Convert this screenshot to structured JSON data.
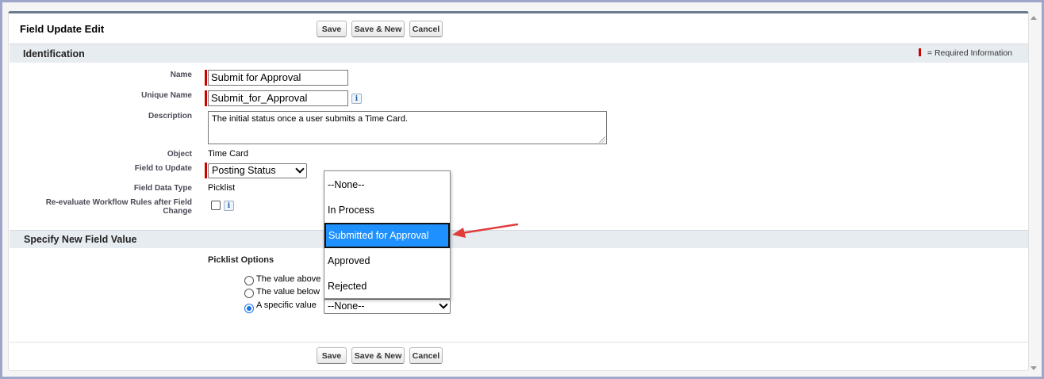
{
  "page": {
    "title": "Field Update Edit",
    "buttons": {
      "save": "Save",
      "save_new": "Save & New",
      "cancel": "Cancel"
    }
  },
  "identification": {
    "header": "Identification",
    "required_legend": "= Required Information",
    "name_label": "Name",
    "name_value": "Submit for Approval",
    "unique_name_label": "Unique Name",
    "unique_name_value": "Submit_for_Approval",
    "description_label": "Description",
    "description_value": "The initial status once a user submits a Time Card.",
    "object_label": "Object",
    "object_value": "Time Card",
    "field_to_update_label": "Field to Update",
    "field_to_update_value": "Posting Status",
    "field_data_type_label": "Field Data Type",
    "field_data_type_value": "Picklist",
    "reevaluate_label_1": "Re-evaluate Workflow Rules after Field",
    "reevaluate_label_2": "Change",
    "reevaluate_checked": false,
    "info_glyph": "i"
  },
  "new_value": {
    "header": "Specify New Field Value",
    "picklist_options_label": "Picklist Options",
    "options": [
      {
        "label": "The value above",
        "selected": false
      },
      {
        "label": "The value below",
        "selected": false
      },
      {
        "label": "A specific value",
        "selected": true
      }
    ],
    "specific_value_select": "--None--"
  },
  "dropdown": {
    "items": [
      "--None--",
      "In Process",
      "Submitted for Approval",
      "Approved",
      "Rejected"
    ],
    "highlighted": "Submitted for Approval"
  },
  "colors": {
    "required_bar": "#cc0000",
    "highlight": "#1e90ff",
    "arrow": "#e03c3c",
    "section_header": "#e7ecf1"
  }
}
